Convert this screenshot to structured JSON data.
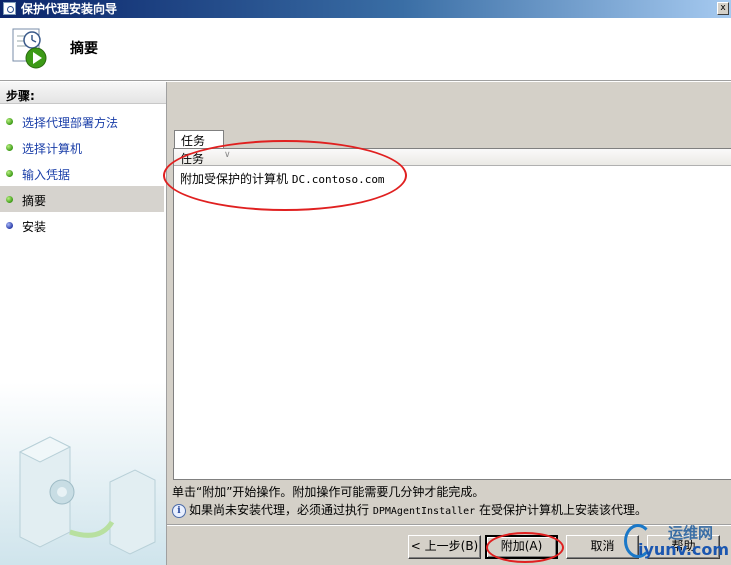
{
  "window": {
    "title": "保护代理安装向导",
    "close_label": "x"
  },
  "header": {
    "title": "摘要",
    "icon": "wizard-clock-play-icon"
  },
  "steps": {
    "title": "步骤:",
    "items": [
      {
        "label": "选择代理部署方法",
        "state": "done"
      },
      {
        "label": "选择计算机",
        "state": "done"
      },
      {
        "label": "输入凭据",
        "state": "done"
      },
      {
        "label": "摘要",
        "state": "current"
      },
      {
        "label": "安装",
        "state": "pending"
      }
    ]
  },
  "tasks": {
    "tab_label": "任务",
    "column_header": "任务",
    "rows": [
      {
        "text": "附加受保护的计算机",
        "computer": "DC.contoso.com"
      }
    ]
  },
  "info": {
    "line1": "单击“附加”开始操作。附加操作可能需要几分钟才能完成。",
    "line2_before": "如果尚未安装代理，必须通过执行",
    "line2_cmd": "DPMAgentInstaller",
    "line2_after": "在受保护计算机上安装该代理。"
  },
  "buttons": {
    "back": "< 上一步(B)",
    "attach": "附加(A)",
    "cancel": "取消",
    "help": "帮助"
  },
  "watermark": {
    "line1": "运维网",
    "line2": "iyunv.com"
  },
  "colors": {
    "annotation": "#e02020",
    "title_bar": "#0a246a",
    "step_link": "#1a3ea8"
  }
}
